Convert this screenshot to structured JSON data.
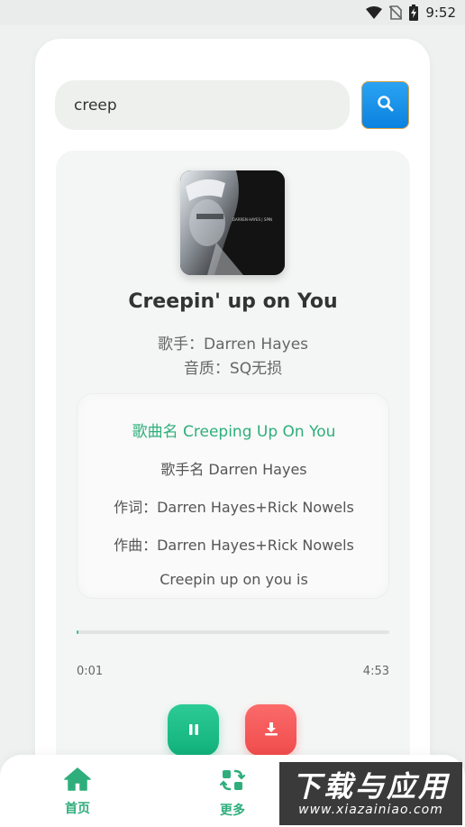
{
  "status_bar": {
    "time": "9:52",
    "icons": [
      "wifi-icon",
      "no-sim-icon",
      "battery-charging-icon"
    ]
  },
  "search": {
    "value": "creep",
    "button_icon": "search-icon"
  },
  "song": {
    "title": "Creepin' up on You",
    "artist": "歌手：Darren Hayes",
    "quality": "音质：SQ无损",
    "cover_text": "DARREN HAYES | SPIN"
  },
  "lyrics": [
    "歌曲名 Creeping Up On You",
    "歌手名 Darren Hayes",
    "作词：Darren Hayes+Rick Nowels",
    "作曲：Darren Hayes+Rick Nowels",
    "Creepin up on you is"
  ],
  "playback": {
    "current_time": "0:01",
    "total_time": "4:53",
    "progress_fraction": 0.004,
    "pause_icon": "pause-icon",
    "download_icon": "download-icon"
  },
  "nav": {
    "home_label": "首页",
    "more_label": "更多"
  },
  "watermark": {
    "main": "下载与应用",
    "sub": "www.xiazainiao.com"
  },
  "colors": {
    "accent_green": "#2fae7c",
    "search_blue": "#0a82e0",
    "download_red": "#f04c4c"
  }
}
